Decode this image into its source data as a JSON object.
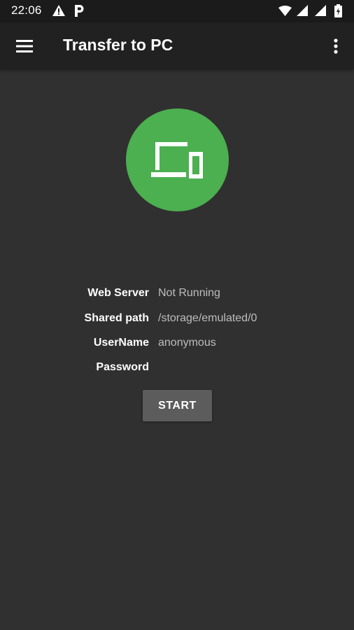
{
  "status_bar": {
    "time": "22:06",
    "icons": [
      "warning-icon",
      "parking-icon",
      "wifi-icon",
      "signal-icon",
      "signal-icon",
      "battery-icon"
    ]
  },
  "app_bar": {
    "title": "Transfer to PC",
    "menu_icon": "hamburger-menu-icon",
    "overflow_icon": "more-vert-icon"
  },
  "hero": {
    "icon": "devices-icon",
    "circle_color": "#4caf50"
  },
  "server_info": [
    {
      "label": "Web Server",
      "value": "Not Running"
    },
    {
      "label": "Shared path",
      "value": "/storage/emulated/0"
    },
    {
      "label": "UserName",
      "value": "anonymous"
    },
    {
      "label": "Password",
      "value": ""
    }
  ],
  "actions": {
    "start_label": "START"
  },
  "colors": {
    "background": "#303030",
    "app_bar": "#212121",
    "status_bar": "#1b1b1b",
    "accent": "#4caf50",
    "button": "#5c5c5c"
  }
}
